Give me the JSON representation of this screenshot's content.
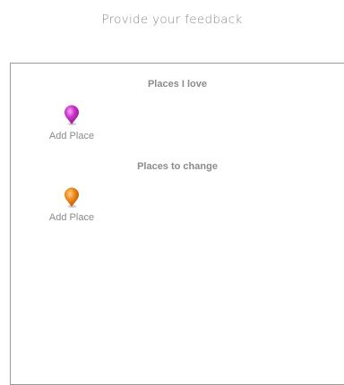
{
  "page": {
    "heading": "Provide your feedback"
  },
  "sections": {
    "love": {
      "title": "Places I love",
      "add_label": "Add Place",
      "pin_icon": "map-pin-icon",
      "pin_color": "#cc33cc"
    },
    "change": {
      "title": "Places to change",
      "add_label": "Add Place",
      "pin_icon": "map-pin-icon",
      "pin_color": "#f08a1c"
    }
  }
}
